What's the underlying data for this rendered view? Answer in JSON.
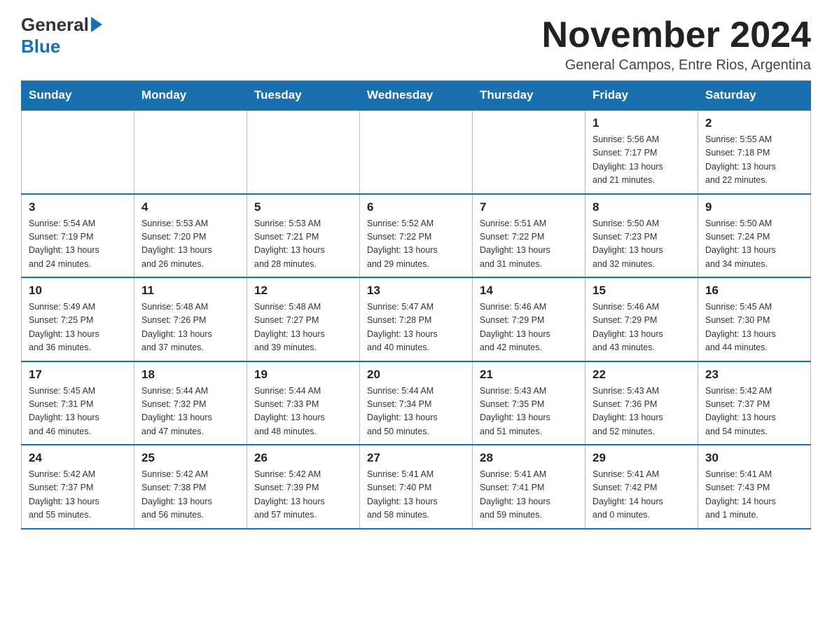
{
  "header": {
    "logo_general": "General",
    "logo_blue": "Blue",
    "month_title": "November 2024",
    "location": "General Campos, Entre Rios, Argentina"
  },
  "weekdays": [
    "Sunday",
    "Monday",
    "Tuesday",
    "Wednesday",
    "Thursday",
    "Friday",
    "Saturday"
  ],
  "weeks": [
    [
      {
        "day": "",
        "info": ""
      },
      {
        "day": "",
        "info": ""
      },
      {
        "day": "",
        "info": ""
      },
      {
        "day": "",
        "info": ""
      },
      {
        "day": "",
        "info": ""
      },
      {
        "day": "1",
        "info": "Sunrise: 5:56 AM\nSunset: 7:17 PM\nDaylight: 13 hours\nand 21 minutes."
      },
      {
        "day": "2",
        "info": "Sunrise: 5:55 AM\nSunset: 7:18 PM\nDaylight: 13 hours\nand 22 minutes."
      }
    ],
    [
      {
        "day": "3",
        "info": "Sunrise: 5:54 AM\nSunset: 7:19 PM\nDaylight: 13 hours\nand 24 minutes."
      },
      {
        "day": "4",
        "info": "Sunrise: 5:53 AM\nSunset: 7:20 PM\nDaylight: 13 hours\nand 26 minutes."
      },
      {
        "day": "5",
        "info": "Sunrise: 5:53 AM\nSunset: 7:21 PM\nDaylight: 13 hours\nand 28 minutes."
      },
      {
        "day": "6",
        "info": "Sunrise: 5:52 AM\nSunset: 7:22 PM\nDaylight: 13 hours\nand 29 minutes."
      },
      {
        "day": "7",
        "info": "Sunrise: 5:51 AM\nSunset: 7:22 PM\nDaylight: 13 hours\nand 31 minutes."
      },
      {
        "day": "8",
        "info": "Sunrise: 5:50 AM\nSunset: 7:23 PM\nDaylight: 13 hours\nand 32 minutes."
      },
      {
        "day": "9",
        "info": "Sunrise: 5:50 AM\nSunset: 7:24 PM\nDaylight: 13 hours\nand 34 minutes."
      }
    ],
    [
      {
        "day": "10",
        "info": "Sunrise: 5:49 AM\nSunset: 7:25 PM\nDaylight: 13 hours\nand 36 minutes."
      },
      {
        "day": "11",
        "info": "Sunrise: 5:48 AM\nSunset: 7:26 PM\nDaylight: 13 hours\nand 37 minutes."
      },
      {
        "day": "12",
        "info": "Sunrise: 5:48 AM\nSunset: 7:27 PM\nDaylight: 13 hours\nand 39 minutes."
      },
      {
        "day": "13",
        "info": "Sunrise: 5:47 AM\nSunset: 7:28 PM\nDaylight: 13 hours\nand 40 minutes."
      },
      {
        "day": "14",
        "info": "Sunrise: 5:46 AM\nSunset: 7:29 PM\nDaylight: 13 hours\nand 42 minutes."
      },
      {
        "day": "15",
        "info": "Sunrise: 5:46 AM\nSunset: 7:29 PM\nDaylight: 13 hours\nand 43 minutes."
      },
      {
        "day": "16",
        "info": "Sunrise: 5:45 AM\nSunset: 7:30 PM\nDaylight: 13 hours\nand 44 minutes."
      }
    ],
    [
      {
        "day": "17",
        "info": "Sunrise: 5:45 AM\nSunset: 7:31 PM\nDaylight: 13 hours\nand 46 minutes."
      },
      {
        "day": "18",
        "info": "Sunrise: 5:44 AM\nSunset: 7:32 PM\nDaylight: 13 hours\nand 47 minutes."
      },
      {
        "day": "19",
        "info": "Sunrise: 5:44 AM\nSunset: 7:33 PM\nDaylight: 13 hours\nand 48 minutes."
      },
      {
        "day": "20",
        "info": "Sunrise: 5:44 AM\nSunset: 7:34 PM\nDaylight: 13 hours\nand 50 minutes."
      },
      {
        "day": "21",
        "info": "Sunrise: 5:43 AM\nSunset: 7:35 PM\nDaylight: 13 hours\nand 51 minutes."
      },
      {
        "day": "22",
        "info": "Sunrise: 5:43 AM\nSunset: 7:36 PM\nDaylight: 13 hours\nand 52 minutes."
      },
      {
        "day": "23",
        "info": "Sunrise: 5:42 AM\nSunset: 7:37 PM\nDaylight: 13 hours\nand 54 minutes."
      }
    ],
    [
      {
        "day": "24",
        "info": "Sunrise: 5:42 AM\nSunset: 7:37 PM\nDaylight: 13 hours\nand 55 minutes."
      },
      {
        "day": "25",
        "info": "Sunrise: 5:42 AM\nSunset: 7:38 PM\nDaylight: 13 hours\nand 56 minutes."
      },
      {
        "day": "26",
        "info": "Sunrise: 5:42 AM\nSunset: 7:39 PM\nDaylight: 13 hours\nand 57 minutes."
      },
      {
        "day": "27",
        "info": "Sunrise: 5:41 AM\nSunset: 7:40 PM\nDaylight: 13 hours\nand 58 minutes."
      },
      {
        "day": "28",
        "info": "Sunrise: 5:41 AM\nSunset: 7:41 PM\nDaylight: 13 hours\nand 59 minutes."
      },
      {
        "day": "29",
        "info": "Sunrise: 5:41 AM\nSunset: 7:42 PM\nDaylight: 14 hours\nand 0 minutes."
      },
      {
        "day": "30",
        "info": "Sunrise: 5:41 AM\nSunset: 7:43 PM\nDaylight: 14 hours\nand 1 minute."
      }
    ]
  ]
}
